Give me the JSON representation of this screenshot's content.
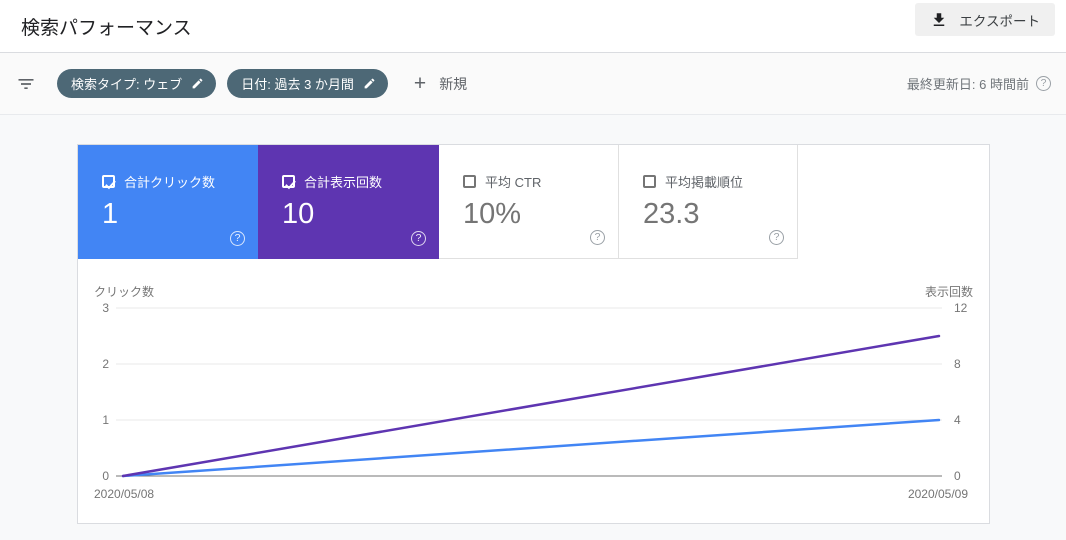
{
  "header": {
    "title": "検索パフォーマンス",
    "export_label": "エクスポート"
  },
  "filter_bar": {
    "chips": [
      {
        "label": "検索タイプ: ウェブ"
      },
      {
        "label": "日付: 過去 3 か月間"
      }
    ],
    "new_label": "新規",
    "last_updated": "最終更新日: 6 時間前",
    "help_glyph": "?",
    "chip_color": "#4d6876"
  },
  "metrics": {
    "cards": [
      {
        "label": "合計クリック数",
        "value": "1",
        "checked": true,
        "color": "#4285f4"
      },
      {
        "label": "合計表示回数",
        "value": "10",
        "checked": true,
        "color": "#5e35b1"
      },
      {
        "label": "平均 CTR",
        "value": "10%",
        "checked": false,
        "color": null
      },
      {
        "label": "平均掲載順位",
        "value": "23.3",
        "checked": false,
        "color": null
      }
    ],
    "help_glyph": "?"
  },
  "chart_data": {
    "type": "line",
    "x": [
      "2020/05/08",
      "2020/05/09"
    ],
    "series": [
      {
        "name": "クリック数",
        "axis": "left",
        "values": [
          0,
          1
        ],
        "color": "#4285f4"
      },
      {
        "name": "表示回数",
        "axis": "right",
        "values": [
          0,
          10
        ],
        "color": "#5e35b1"
      }
    ],
    "left_axis": {
      "label": "クリック数",
      "ticks": [
        0,
        1,
        2,
        3
      ],
      "max": 3
    },
    "right_axis": {
      "label": "表示回数",
      "ticks": [
        0,
        4,
        8,
        12
      ],
      "max": 12
    },
    "grid": true,
    "legend": "none"
  }
}
